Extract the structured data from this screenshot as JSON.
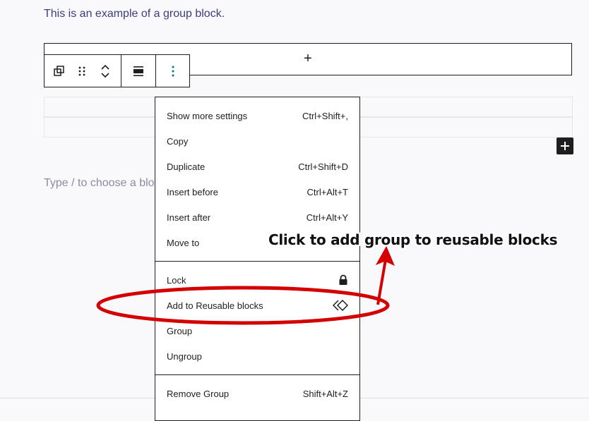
{
  "editor": {
    "intro_text": "This is an example of a group block.",
    "placeholder_text": "Type / to choose a block"
  },
  "toolbar": {
    "buttons": [
      {
        "icon": "group-transform-icon"
      },
      {
        "icon": "drag-handle-icon"
      },
      {
        "icon": "move-up-icon"
      },
      {
        "icon": "move-down-icon"
      },
      {
        "icon": "align-icon"
      },
      {
        "icon": "options-icon"
      }
    ]
  },
  "menu": {
    "sections": [
      {
        "items": [
          {
            "label": "Show more settings",
            "shortcut": "Ctrl+Shift+,"
          },
          {
            "label": "Copy",
            "shortcut": ""
          },
          {
            "label": "Duplicate",
            "shortcut": "Ctrl+Shift+D"
          },
          {
            "label": "Insert before",
            "shortcut": "Ctrl+Alt+T"
          },
          {
            "label": "Insert after",
            "shortcut": "Ctrl+Alt+Y"
          },
          {
            "label": "Move to",
            "shortcut": ""
          }
        ]
      },
      {
        "items": [
          {
            "label": "Lock",
            "icon": "lock-icon"
          },
          {
            "label": "Add to Reusable blocks",
            "icon": "reusable-block-icon"
          },
          {
            "label": "Group",
            "shortcut": ""
          },
          {
            "label": "Ungroup",
            "shortcut": ""
          }
        ]
      },
      {
        "items": [
          {
            "label": "Remove Group",
            "shortcut": "Shift+Alt+Z"
          }
        ]
      }
    ]
  },
  "annotation": {
    "text": "Click to add group to reusable blocks",
    "color": "#d40000"
  }
}
